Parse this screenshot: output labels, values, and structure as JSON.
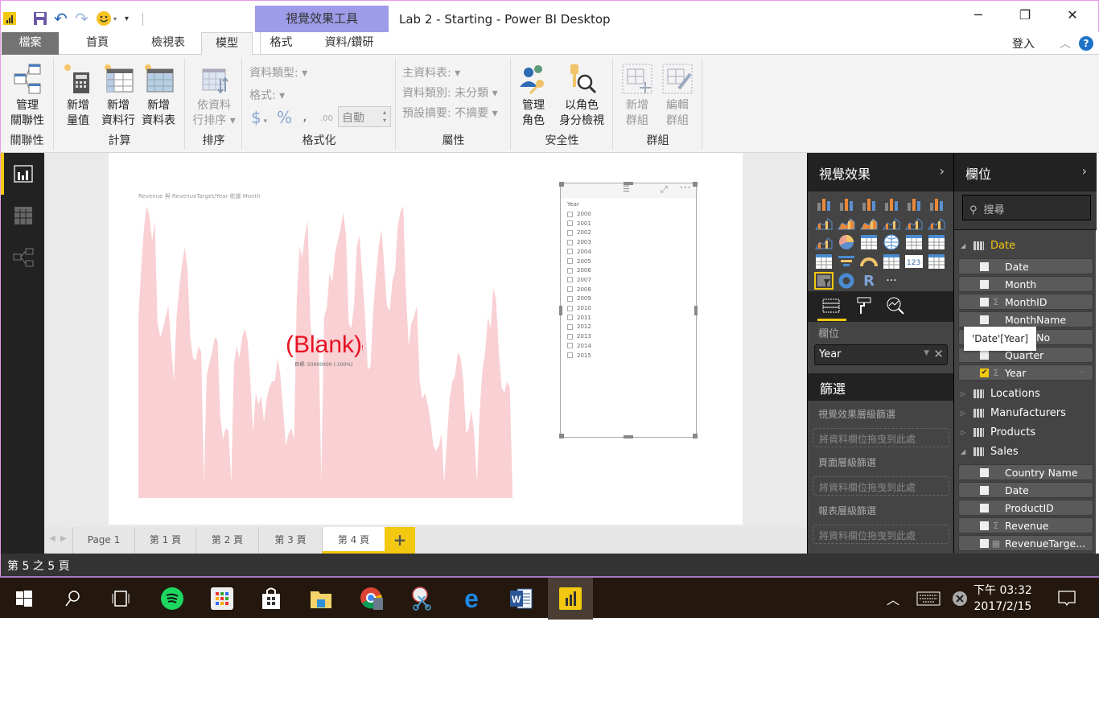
{
  "window": {
    "title": "Lab 2 - Starting - Power BI Desktop",
    "context_tab_group": "視覺效果工具",
    "minimize": "─",
    "restore": "❐",
    "close": "✕",
    "login": "登入",
    "help": "?",
    "collapse": "︿"
  },
  "ribbon_tabs": [
    "檔案",
    "首頁",
    "檢視表",
    "模型",
    "格式",
    "資料/鑽研"
  ],
  "ribbon": {
    "relationships": {
      "manage": [
        "管理",
        "關聯性"
      ],
      "label": "關聯性"
    },
    "calculations": {
      "new_measure": [
        "新增",
        "量值"
      ],
      "new_column": [
        "新增",
        "資料行"
      ],
      "new_table": [
        "新增",
        "資料表"
      ],
      "label": "計算"
    },
    "sort": {
      "sort_by_column": [
        "依資料",
        "行排序"
      ],
      "label": "排序"
    },
    "formatting": {
      "data_type": "資料類型:",
      "format": "格式:",
      "currency": "$",
      "percent": "%",
      "comma": ",",
      "decimal": ".00",
      "decimal_value": "自動",
      "label": "格式化"
    },
    "properties": {
      "home_table": "主資料表:",
      "data_category": "資料類別: 未分類",
      "default_summarization": "預設摘要: 不摘要",
      "label": "屬性"
    },
    "security": {
      "manage_roles": [
        "管理",
        "角色"
      ],
      "view_as_roles": [
        "以角色",
        "身分檢視"
      ],
      "label": "安全性"
    },
    "groups": {
      "new_group": [
        "新增",
        "群組"
      ],
      "edit_group": [
        "編輯",
        "群組"
      ],
      "label": "群組"
    }
  },
  "rail": [
    "report-view",
    "data-view",
    "relationships-view"
  ],
  "report": {
    "chart_title": "Revenue 與 RevenueTarget/Year 依據 Month",
    "kpi_value": "(Blank)",
    "kpi_indicator": "!",
    "kpi_target": "目標: 50000000 (-100%)",
    "slicer": {
      "title": "Year",
      "items": [
        "2000",
        "2001",
        "2002",
        "2003",
        "2004",
        "2005",
        "2006",
        "2007",
        "2008",
        "2009",
        "2010",
        "2011",
        "2012",
        "2013",
        "2014",
        "2015"
      ]
    }
  },
  "page_tabs": {
    "items": [
      "Page 1",
      "第 1 頁",
      "第 2 頁",
      "第 3 頁",
      "第 4 頁"
    ],
    "active": "第 4 頁",
    "add": "+"
  },
  "status": "第 5 之 5 頁",
  "visualizations": {
    "header": "視覺效果",
    "chevron": "›",
    "fields_label": "欄位",
    "field_value": "Year",
    "filters_header": "篩選",
    "visual_level": "視覺效果層級篩選",
    "page_level": "頁面層級篩選",
    "report_level": "報表層級篩選",
    "drop_hint": "將資料欄位拖曳到此處",
    "more": "···",
    "r_label": "R",
    "card_label": "123"
  },
  "fields": {
    "header": "欄位",
    "chevron": "›",
    "search_placeholder": "搜尋",
    "tooltip": "'Date'[Year]",
    "tables": [
      {
        "name": "Date",
        "expanded": true,
        "fields": [
          {
            "name": "Date",
            "agg": "",
            "checked": false
          },
          {
            "name": "Month",
            "agg": "",
            "checked": false
          },
          {
            "name": "MonthID",
            "agg": "Σ",
            "checked": false
          },
          {
            "name": "MonthName",
            "agg": "",
            "checked": false
          },
          {
            "name": "MonthNo",
            "agg": "",
            "checked": false
          },
          {
            "name": "Quarter",
            "agg": "",
            "checked": false
          },
          {
            "name": "Year",
            "agg": "Σ",
            "checked": true
          }
        ]
      },
      {
        "name": "Locations",
        "expanded": false
      },
      {
        "name": "Manufacturers",
        "expanded": false
      },
      {
        "name": "Products",
        "expanded": false
      },
      {
        "name": "Sales",
        "expanded": true,
        "fields": [
          {
            "name": "Country Name",
            "agg": "",
            "checked": false
          },
          {
            "name": "Date",
            "agg": "",
            "checked": false
          },
          {
            "name": "ProductID",
            "agg": "",
            "checked": false
          },
          {
            "name": "Revenue",
            "agg": "Σ",
            "checked": false
          },
          {
            "name": "RevenueTarge...",
            "agg": "calc",
            "checked": false
          }
        ]
      }
    ]
  },
  "taskbar": {
    "time": "下午 03:32",
    "date": "2017/2/15",
    "apps": [
      "start",
      "search",
      "task-view",
      "spotify",
      "apps",
      "store",
      "file-explorer",
      "chrome",
      "snipping-tool",
      "edge",
      "word",
      "power-bi"
    ]
  },
  "colors": {
    "accent": "#f2c811",
    "kpi_red": "#e81123",
    "area_fill": "#f9d0d3",
    "context_tab": "#9e9be8"
  }
}
